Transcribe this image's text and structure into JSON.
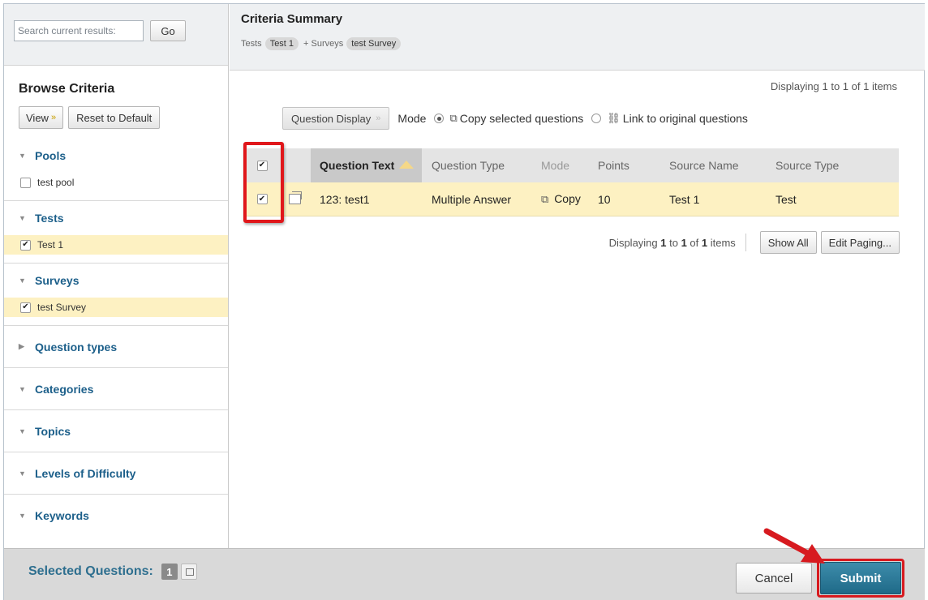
{
  "sidebar": {
    "search_placeholder": "Search current results:",
    "go_label": "Go",
    "browse_title": "Browse Criteria",
    "view_label": "View",
    "reset_label": "Reset to Default",
    "sections": [
      {
        "label": "Pools",
        "expanded": true,
        "items": [
          {
            "label": "test pool",
            "checked": false
          }
        ]
      },
      {
        "label": "Tests",
        "expanded": true,
        "items": [
          {
            "label": "Test 1",
            "checked": true
          }
        ]
      },
      {
        "label": "Surveys",
        "expanded": true,
        "items": [
          {
            "label": "test Survey",
            "checked": true
          }
        ]
      },
      {
        "label": "Question types",
        "expanded": false
      },
      {
        "label": "Categories",
        "expanded": true
      },
      {
        "label": "Topics",
        "expanded": true
      },
      {
        "label": "Levels of Difficulty",
        "expanded": true
      },
      {
        "label": "Keywords",
        "expanded": true
      }
    ]
  },
  "summary": {
    "title": "Criteria Summary",
    "tests_prefix": "Tests",
    "tests_tag": "Test 1",
    "surveys_prefix": "+ Surveys",
    "surveys_tag": "test Survey"
  },
  "main": {
    "displaying_top": "Displaying 1 to 1 of 1 items",
    "question_display_label": "Question Display",
    "mode_label": "Mode",
    "copy_option": "Copy selected questions",
    "link_option": "Link to original questions",
    "columns": [
      "Question Text",
      "Question Type",
      "Mode",
      "Points",
      "Source Name",
      "Source Type"
    ],
    "rows": [
      {
        "question_text": "123: test1",
        "question_type": "Multiple Answer",
        "mode": "Copy",
        "points": "10",
        "source_name": "Test 1",
        "source_type": "Test",
        "checked": true
      }
    ],
    "paging": {
      "prefix": "Displaying ",
      "from": "1",
      "to_word": " to ",
      "to": "1",
      "of_word": " of ",
      "total": "1",
      "suffix": " items"
    },
    "show_all_label": "Show All",
    "edit_paging_label": "Edit Paging..."
  },
  "footer": {
    "selected_label": "Selected Questions:",
    "selected_count": "1",
    "cancel_label": "Cancel",
    "submit_label": "Submit"
  },
  "colors": {
    "link_blue": "#1c5f8a",
    "selected_row": "#fdf1c2",
    "submit": "#2a7a99",
    "annotation_red": "#e0171b"
  }
}
